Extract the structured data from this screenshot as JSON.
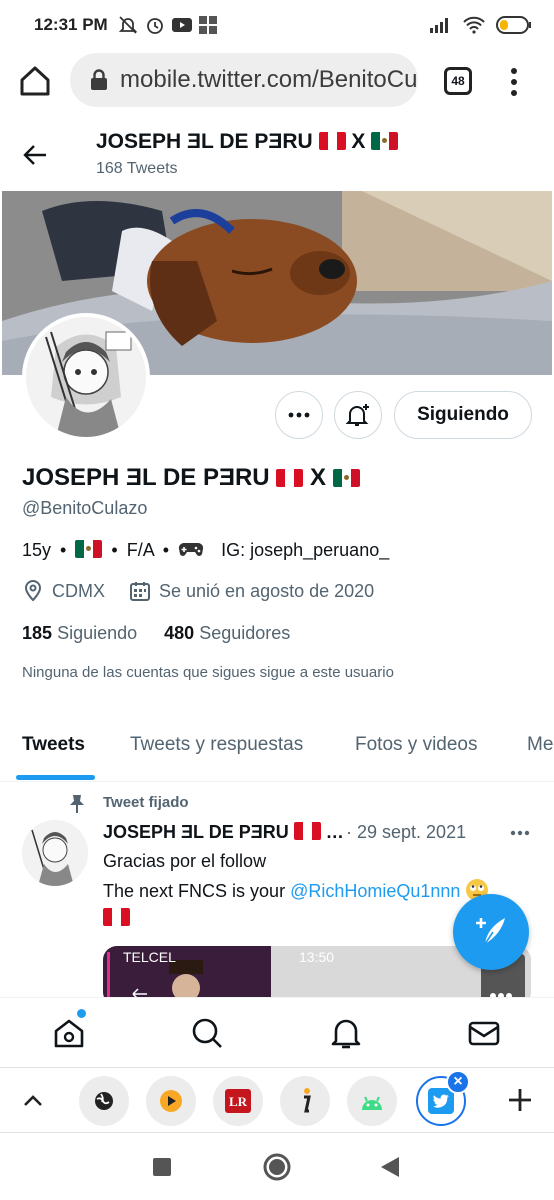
{
  "status_bar": {
    "time": "12:31 PM",
    "battery_color": "#f5b400"
  },
  "browser": {
    "url": "mobile.twitter.com/BenitoCulazo",
    "tab_count": "48"
  },
  "header": {
    "name": "JOSEPH ƎL DE PƎRU",
    "name_sep": "X",
    "tweets_count": "168 Tweets"
  },
  "profile": {
    "follow_label": "Siguiendo",
    "handle": "@BenitoCulazo",
    "bio": {
      "age": "15y",
      "dot": "•",
      "fa": "F/A",
      "ig": "IG: joseph_peruano_"
    },
    "location": "CDMX",
    "joined": "Se unió en agosto de 2020",
    "following_count": "185",
    "following_label": "Siguiendo",
    "followers_count": "480",
    "followers_label": "Seguidores",
    "note": "Ninguna de las cuentas que sigues sigue a este usuario"
  },
  "tabs": [
    "Tweets",
    "Tweets y respuestas",
    "Fotos y videos",
    "Me Gusta"
  ],
  "tweet": {
    "pinned_label": "Tweet fijado",
    "name": "JOSEPH ƎL DE PƎRU",
    "ellipsis": "…",
    "date": "· 29 sept. 2021",
    "line1": "Gracias por el follow",
    "line2_prefix": "The next FNCS is your",
    "mention": "@RichHomieQu1nnn",
    "media_carrier": "TELCEL",
    "media_time": "13:50"
  },
  "colors": {
    "accent": "#1d9bf0",
    "text": "#0f1419",
    "muted": "#536471",
    "chrome_blue": "#1a73e8"
  }
}
